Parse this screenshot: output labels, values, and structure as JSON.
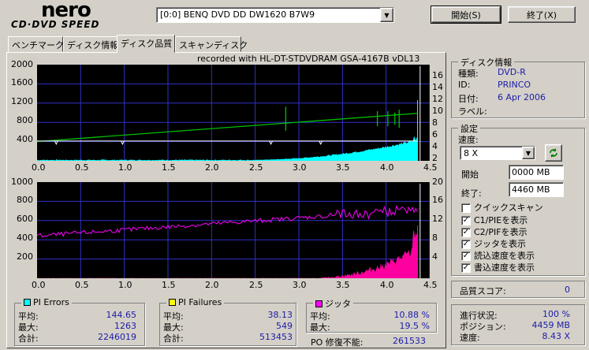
{
  "app": {
    "logo_main": "nero",
    "logo_sub": "CD·DVD SPEED"
  },
  "drive": {
    "selected": "[0:0]   BENQ DVD DD DW1620 B7W9"
  },
  "buttons": {
    "start": "開始(S)",
    "exit": "終了(X)"
  },
  "tabs": [
    "ベンチマーク",
    "ディスク情報",
    "ディスク品質",
    "スキャンディスク"
  ],
  "active_tab": 2,
  "chart": {
    "recorded_with": "recorded with HL-DT-STDVDRAM GSA-4167B vDL13",
    "top": {
      "y_left": [
        "2000",
        "1600",
        "1200",
        "800",
        "400"
      ],
      "y_right": [
        "16",
        "14",
        "12",
        "10",
        "8",
        "6",
        "4",
        "2"
      ],
      "x": [
        "0.0",
        "0.5",
        "1.0",
        "1.5",
        "2.0",
        "2.5",
        "3.0",
        "3.5",
        "4.0",
        "4.5"
      ]
    },
    "bottom": {
      "y_left": [
        "1000",
        "800",
        "600",
        "400",
        "200"
      ],
      "y_right": [
        "20",
        "16",
        "12",
        "8",
        "4"
      ],
      "x": [
        "0.0",
        "0.5",
        "1.0",
        "1.5",
        "2.0",
        "2.5",
        "3.0",
        "3.5",
        "4.0",
        "4.5"
      ]
    }
  },
  "chart_data": [
    {
      "type": "area",
      "title": "PI Errors",
      "xlim": [
        0,
        4.5
      ],
      "ylim": [
        0,
        2000
      ],
      "y2lim": [
        0,
        16
      ],
      "series": [
        {
          "name": "PI Errors",
          "color": "#00ffff"
        },
        {
          "name": "Read speed",
          "color": "#00c000"
        },
        {
          "name": "Write speed",
          "color": "#ffffff"
        }
      ]
    },
    {
      "type": "area",
      "title": "PI Failures",
      "xlim": [
        0,
        4.5
      ],
      "ylim": [
        0,
        1000
      ],
      "y2lim": [
        0,
        20
      ],
      "series": [
        {
          "name": "PI Failures",
          "color": "#ff00a0"
        },
        {
          "name": "Jitter",
          "color": "#ff00ff"
        }
      ]
    }
  ],
  "stats": {
    "pi_errors": {
      "title": "PI Errors",
      "color": "#00ffff",
      "avg_label": "平均:",
      "avg": "144.65",
      "max_label": "最大:",
      "max": "1263",
      "total_label": "合計:",
      "total": "2246019"
    },
    "pi_failures": {
      "title": "PI Failures",
      "color": "#ffff00",
      "avg_label": "平均:",
      "avg": "38.13",
      "max_label": "最大:",
      "max": "549",
      "total_label": "合計:",
      "total": "513453"
    },
    "jitter": {
      "title": "ジッタ",
      "color": "#ff00ff",
      "avg_label": "平均:",
      "avg": "10.88 %",
      "max_label": "最大:",
      "max": "19.5 %",
      "po_label": "PO 修復不能:",
      "po": "261533"
    }
  },
  "disc_info": {
    "title": "ディスク情報",
    "type_label": "種類:",
    "type": "DVD-R",
    "id_label": "ID:",
    "id": "PRINCO",
    "date_label": "日付:",
    "date": "6 Apr 2006",
    "label_label": "ラベル:",
    "label": ""
  },
  "settings": {
    "title": "設定",
    "speed_label": "速度:",
    "speed": "8 X",
    "start_label": "開始",
    "start": "0000 MB",
    "end_label": "終了:",
    "end": "4460 MB",
    "checks": [
      {
        "label": "クイックスキャン",
        "checked": false
      },
      {
        "label": "C1/PIEを表示",
        "checked": true
      },
      {
        "label": "C2/PIFを表示",
        "checked": true
      },
      {
        "label": "ジッタを表示",
        "checked": true
      },
      {
        "label": "読込速度を表示",
        "checked": true
      },
      {
        "label": "書込速度を表示",
        "checked": true
      }
    ]
  },
  "quality": {
    "label": "品質スコア:",
    "value": "0"
  },
  "progress": {
    "progress_label": "進行状況:",
    "progress": "100 %",
    "position_label": "ポジション:",
    "position": "4459 MB",
    "speed_label": "速度:",
    "speed": "8.43 X"
  }
}
